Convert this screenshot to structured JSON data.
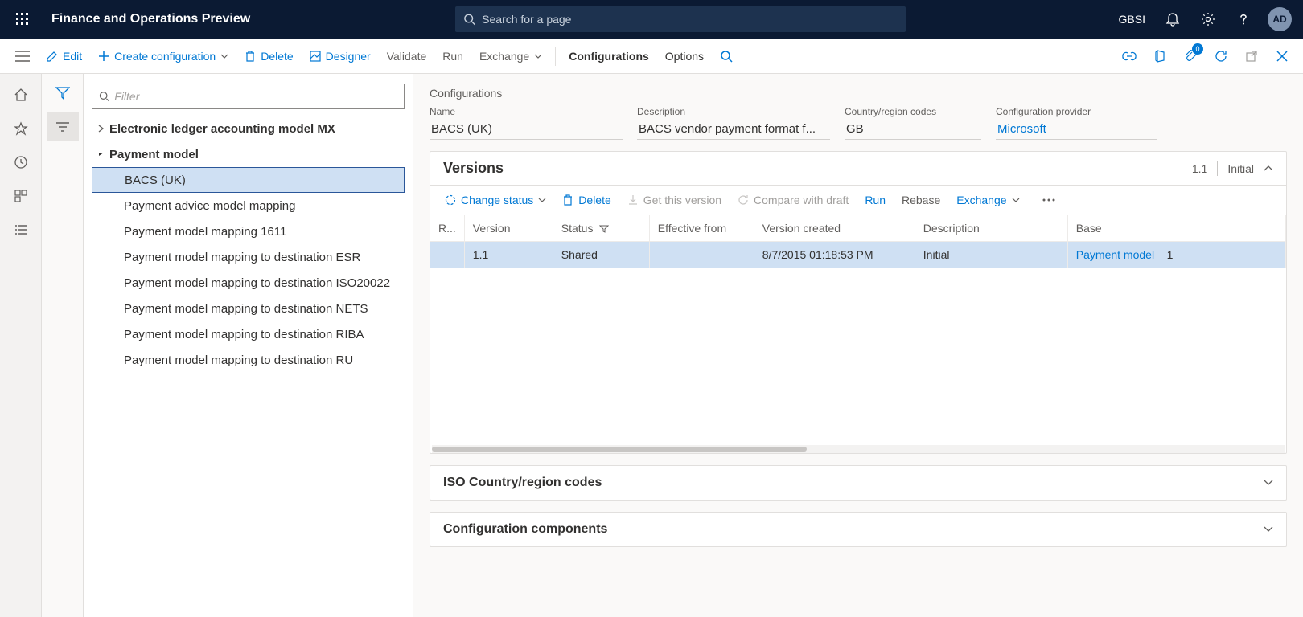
{
  "header": {
    "app_title": "Finance and Operations Preview",
    "search_placeholder": "Search for a page",
    "company": "GBSI",
    "avatar": "AD"
  },
  "action_bar": {
    "edit": "Edit",
    "create": "Create configuration",
    "delete": "Delete",
    "designer": "Designer",
    "validate": "Validate",
    "run": "Run",
    "exchange": "Exchange",
    "configurations": "Configurations",
    "options": "Options",
    "attach_badge": "0"
  },
  "tree": {
    "filter_placeholder": "Filter",
    "nodes": {
      "n0": "Electronic ledger accounting model MX",
      "n1": "Payment model",
      "n2": "BACS (UK)",
      "n3": "Payment advice model mapping",
      "n4": "Payment model mapping 1611",
      "n5": "Payment model mapping to destination ESR",
      "n6": "Payment model mapping to destination ISO20022",
      "n7": "Payment model mapping to destination NETS",
      "n8": "Payment model mapping to destination RIBA",
      "n9": "Payment model mapping to destination RU"
    }
  },
  "content": {
    "page_title": "Configurations",
    "fields": {
      "name_lbl": "Name",
      "name": "BACS (UK)",
      "desc_lbl": "Description",
      "desc": "BACS vendor payment format f...",
      "country_lbl": "Country/region codes",
      "country": "GB",
      "provider_lbl": "Configuration provider",
      "provider": "Microsoft"
    }
  },
  "versions": {
    "title": "Versions",
    "summary_ver": "1.1",
    "summary_status": "Initial",
    "toolbar": {
      "change_status": "Change status",
      "delete": "Delete",
      "get_version": "Get this version",
      "compare": "Compare with draft",
      "run": "Run",
      "rebase": "Rebase",
      "exchange": "Exchange"
    },
    "columns": {
      "c0": "R...",
      "c1": "Version",
      "c2": "Status",
      "c3": "Effective from",
      "c4": "Version created",
      "c5": "Description",
      "c6": "Base"
    },
    "rows": [
      {
        "r0": "",
        "r1": "1.1",
        "r2": "Shared",
        "r3": "",
        "r4": "8/7/2015 01:18:53 PM",
        "r5": "Initial",
        "r6_base": "Payment model",
        "r6_num": "1"
      }
    ]
  },
  "sections": {
    "iso": "ISO Country/region codes",
    "components": "Configuration components"
  }
}
